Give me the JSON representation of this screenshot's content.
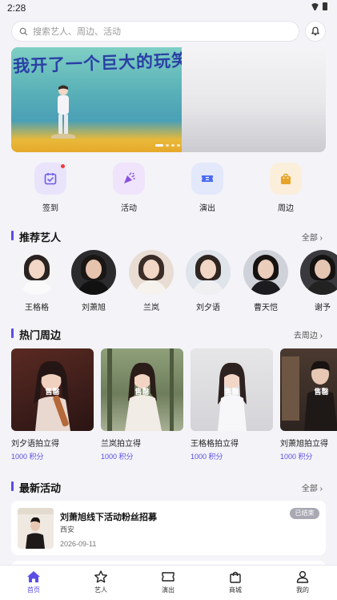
{
  "status": {
    "time": "2:28"
  },
  "search": {
    "placeholder": "搜索艺人、周边、活动"
  },
  "banner": {
    "title": "我开了一个巨大的玩笑"
  },
  "quick_entries": [
    {
      "label": "签到",
      "icon": "calendar-check-icon",
      "color": "#6b5cf0",
      "bg": "#e9e4fb"
    },
    {
      "label": "活动",
      "icon": "party-popper-icon",
      "color": "#8a4fe0",
      "bg": "#efe4fb"
    },
    {
      "label": "演出",
      "icon": "ticket-icon",
      "color": "#4b6cf0",
      "bg": "#e3e8fb"
    },
    {
      "label": "周边",
      "icon": "shopping-bag-icon",
      "color": "#e8a428",
      "bg": "#fbefdc"
    }
  ],
  "recommended_artists": {
    "title": "推荐艺人",
    "more": "全部",
    "items": [
      {
        "name": "王格格"
      },
      {
        "name": "刘萧旭"
      },
      {
        "name": "兰岚"
      },
      {
        "name": "刘夕语"
      },
      {
        "name": "曹天恺"
      },
      {
        "name": "谢予"
      }
    ]
  },
  "hot_goods": {
    "title": "热门周边",
    "more": "去周边",
    "items": [
      {
        "name": "刘夕语拍立得",
        "points": "1000 积分",
        "status": "售罄"
      },
      {
        "name": "兰岚拍立得",
        "points": "1000 积分",
        "status": "售罄"
      },
      {
        "name": "王格格拍立得",
        "points": "1000 积分",
        "status": "售罄"
      },
      {
        "name": "刘萧旭拍立得",
        "points": "1000 积分",
        "status": "售罄"
      }
    ]
  },
  "latest_activities": {
    "title": "最新活动",
    "more": "全部",
    "items": [
      {
        "title": "刘萧旭线下活动粉丝招募",
        "place": "西安",
        "date": "2026-09-11",
        "status": "已结束"
      }
    ]
  },
  "tabbar": {
    "items": [
      {
        "label": "首页",
        "icon": "home-icon",
        "active": true
      },
      {
        "label": "艺人",
        "icon": "star-icon",
        "active": false
      },
      {
        "label": "演出",
        "icon": "ticket-icon",
        "active": false
      },
      {
        "label": "商城",
        "icon": "shopping-bag-icon",
        "active": false
      },
      {
        "label": "我的",
        "icon": "user-icon",
        "active": false
      }
    ]
  },
  "colors": {
    "accent": "#5b4ee6",
    "badge_gray": "#a9a9b3",
    "background": "#f3f3f8"
  }
}
